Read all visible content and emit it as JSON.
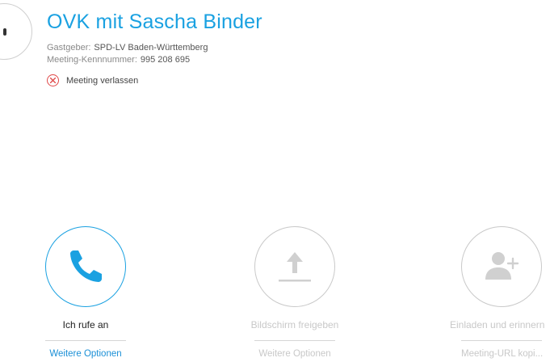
{
  "meeting": {
    "title": "OVK mit Sascha Binder",
    "host_label": "Gastgeber:",
    "host_value": "SPD-LV Baden-Württemberg",
    "id_label": "Meeting-Kennnummer:",
    "id_value": "995 208 695",
    "leave_label": "Meeting verlassen"
  },
  "actions": {
    "call": {
      "label": "Ich rufe an",
      "options": "Weitere Optionen",
      "icon": "phone-icon",
      "state": "active"
    },
    "share": {
      "label": "Bildschirm freigeben",
      "options": "Weitere Optionen",
      "icon": "upload-icon",
      "state": "disabled"
    },
    "invite": {
      "label": "Einladen und erinnern",
      "options": "Meeting-URL kopi...",
      "icon": "add-person-icon",
      "state": "disabled"
    }
  },
  "colors": {
    "accent": "#1aa1e1",
    "link": "#1a8fd6",
    "leave_icon": "#e04848",
    "disabled_text": "#c8c8c8",
    "disabled_icon": "#d0d0d0"
  }
}
